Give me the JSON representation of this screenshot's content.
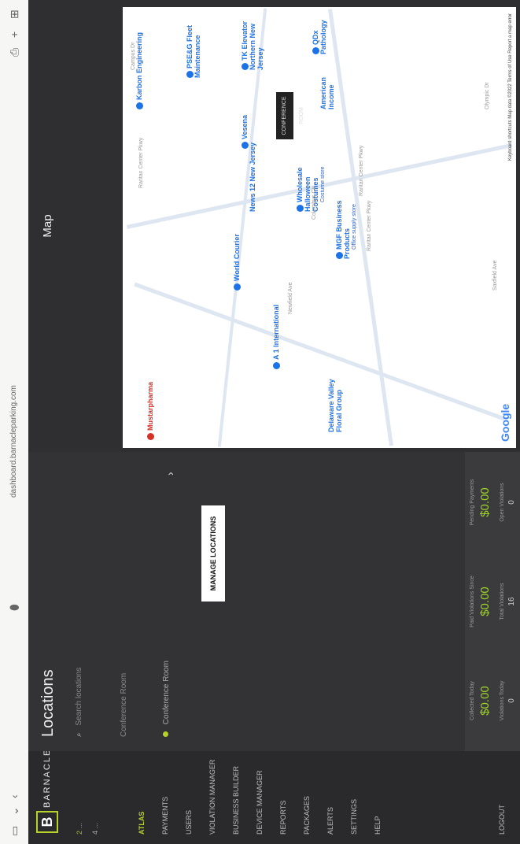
{
  "browser": {
    "url": "dashboard.barnacleparking.com"
  },
  "brand": {
    "logo_letter": "B",
    "name": "BARNACLE"
  },
  "user": {
    "line1": "2 ...",
    "line2": "4 ..."
  },
  "sidebar": {
    "items": [
      {
        "label": "ATLAS",
        "active": true
      },
      {
        "label": "PAYMENTS"
      },
      {
        "label": "USERS"
      },
      {
        "label": "VIOLATION MANAGER"
      },
      {
        "label": "BUSINESS BUILDER"
      },
      {
        "label": "DEVICE MANAGER"
      },
      {
        "label": "REPORTS"
      },
      {
        "label": "PACKAGES"
      },
      {
        "label": "ALERTS"
      },
      {
        "label": "SETTINGS"
      },
      {
        "label": "HELP"
      }
    ],
    "logout": "LOGOUT"
  },
  "locations": {
    "title": "Locations",
    "search_placeholder": "Search locations",
    "rows": [
      {
        "label": "Conference Room",
        "selected": false
      },
      {
        "label": "Conference Room",
        "selected": true
      }
    ],
    "manage_button": "MANAGE LOCATIONS"
  },
  "stats": {
    "top": [
      {
        "label": "Collected Today",
        "value": "$0.00"
      },
      {
        "label": "Paid Violations Since",
        "value": "$0.00"
      },
      {
        "label": "Pending Payments",
        "value": "$0.00"
      }
    ],
    "bottom": [
      {
        "label": "Violations Today",
        "value": "0"
      },
      {
        "label": "Total Violations",
        "value": "16"
      },
      {
        "label": "Open Violations",
        "value": "0"
      }
    ]
  },
  "map": {
    "title": "Map",
    "places": [
      {
        "name": "Karbon Engineering",
        "color": "blue"
      },
      {
        "name": "PSE&G Fleet Maintenance",
        "color": "blue"
      },
      {
        "name": "TK Elevator Northern New Jersey",
        "color": "blue"
      },
      {
        "name": "QDx Pathology",
        "color": "blue"
      },
      {
        "name": "Vesena",
        "color": "blue"
      },
      {
        "name": "Wholesale Halloween Costumes",
        "sub": "Costume store",
        "color": "blue"
      },
      {
        "name": "MGF Business Products",
        "sub": "Office supply store",
        "color": "blue"
      },
      {
        "name": "World Courier",
        "color": "blue"
      },
      {
        "name": "A 1 International",
        "color": "blue"
      },
      {
        "name": "Mustarpharma",
        "color": "red"
      },
      {
        "name": "Delaware Valley Floral Group",
        "color": "blue"
      },
      {
        "name": "American Income",
        "color": "blue"
      },
      {
        "name": "News 12 New Jersey",
        "color": "blue"
      }
    ],
    "streets": [
      "Raritan Center Pkwy",
      "Raritan Center Pkwy",
      "Raritan Center Pkwy",
      "Campus Dr",
      "Olympic Dr",
      "Saxfield Ave",
      "Newfield Ave",
      "Columbus Cir"
    ],
    "tooltip": "CONFERENCE ROOM",
    "google": "Google",
    "attribution": "Keyboard shortcuts   Map data ©2022   Terms of Use   Report a map error"
  }
}
